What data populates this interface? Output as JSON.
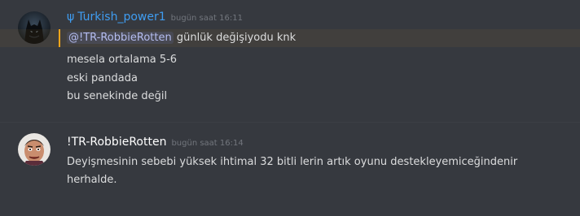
{
  "messages": [
    {
      "username": "Turkish_power1",
      "username_color": "#3f9df2",
      "role_icon": "ψ",
      "timestamp": "bugün saat 16:11",
      "mention": "@!TR-RobbieRotten",
      "first_line_rest": " günlük değişiyodu knk",
      "lines": [
        "mesela ortalama 5-6",
        "eski pandada",
        "bu senekinde değil"
      ]
    },
    {
      "username": "!TR-RobbieRotten",
      "username_color": "#ffffff",
      "timestamp": "bugün saat 16:14",
      "lines": [
        "Deyişmesinin sebebi yüksek ihtimal 32 bitli lerin artık oyunu destekleyemiceğindenir",
        "herhalde."
      ]
    }
  ],
  "colors": {
    "background": "#36393f",
    "text": "#dcddde",
    "mention_bar": "#faa61a",
    "mention_text": "#b5bdf0",
    "timestamp": "#72767d"
  },
  "icons": [
    "psi-role-icon",
    "avatar-batman",
    "avatar-robbie-rotten"
  ]
}
